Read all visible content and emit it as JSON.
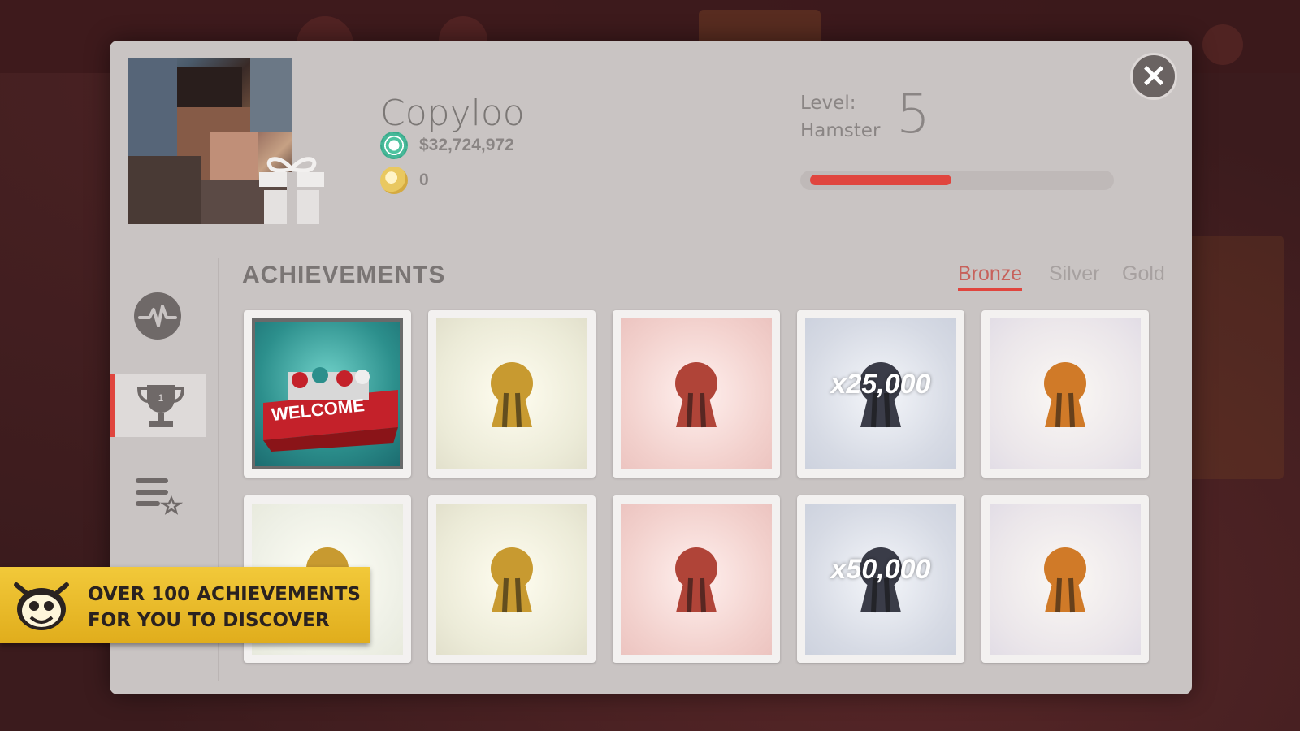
{
  "profile": {
    "name": "Copyloo",
    "chips": "$32,724,972",
    "coins": "0",
    "level_label": "Level:",
    "level_rank": "Hamster",
    "level_value": "5",
    "xp_progress": 0.48
  },
  "icons": {
    "close": "close-icon",
    "activity": "activity-icon",
    "trophy": "trophy-icon",
    "list": "list-star-icon",
    "chip": "chip-icon",
    "coin": "coin-icon",
    "gift": "gift-icon"
  },
  "achievements": {
    "title": "ACHIEVEMENTS",
    "tabs": [
      "Bronze",
      "Silver",
      "Gold"
    ],
    "active_tab": "Bronze",
    "cards": [
      {
        "kind": "welcome",
        "text": "WELCOME",
        "unlocked": true
      },
      {
        "kind": "gold-coins",
        "unlocked": false
      },
      {
        "kind": "red-3",
        "unlocked": false
      },
      {
        "kind": "blue",
        "text": "x25,000",
        "unlocked": false
      },
      {
        "kind": "orange",
        "unlocked": false
      },
      {
        "kind": "chips-tray",
        "unlocked": false
      },
      {
        "kind": "gold-coins",
        "unlocked": false
      },
      {
        "kind": "red-5",
        "unlocked": false
      },
      {
        "kind": "blue",
        "text": "x50,000",
        "unlocked": false
      },
      {
        "kind": "orange",
        "unlocked": false
      }
    ]
  },
  "promo": {
    "line1": "OVER 100 ACHIEVEMENTS",
    "line2": "FOR YOU TO DISCOVER"
  },
  "colors": {
    "accent": "#e0453e",
    "panel": "#c9c4c3",
    "promo": "#f2c93a"
  }
}
